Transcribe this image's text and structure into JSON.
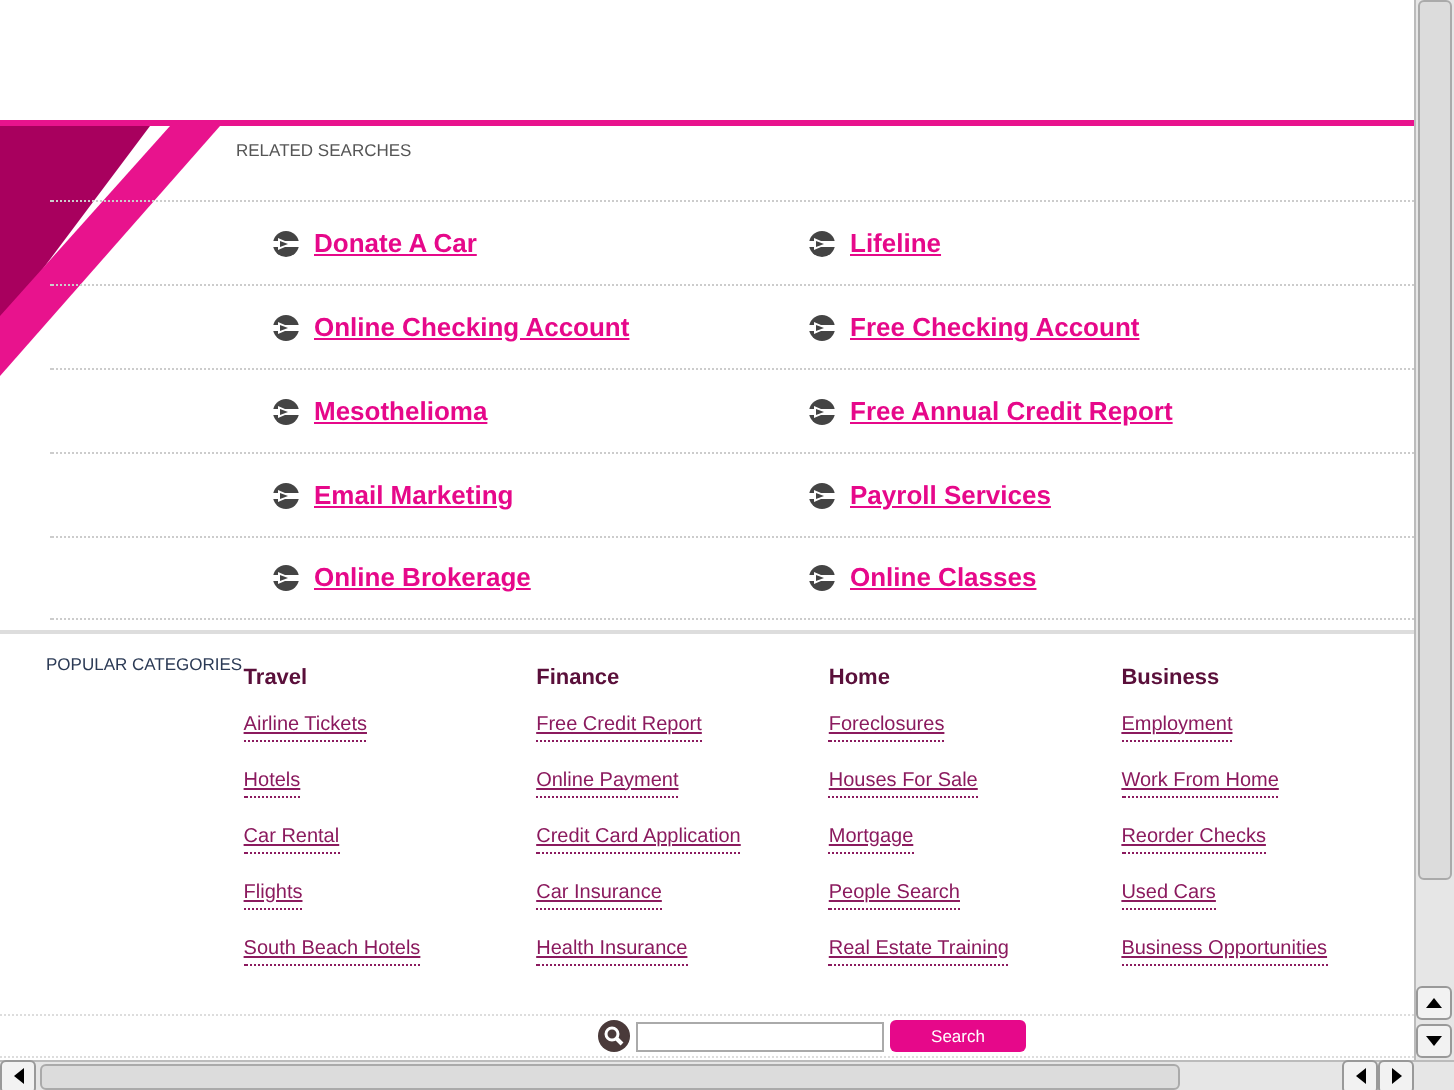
{
  "related_searches": {
    "label": "RELATED SEARCHES",
    "links": [
      "Donate A Car",
      "Lifeline",
      "Online Checking Account",
      "Free Checking Account",
      "Mesothelioma",
      "Free Annual Credit Report",
      "Email Marketing",
      "Payroll Services",
      "Online Brokerage",
      "Online Classes"
    ]
  },
  "popular_categories": {
    "label": "POPULAR CATEGORIES",
    "columns": [
      {
        "title": "Travel",
        "items": [
          "Airline Tickets",
          "Hotels",
          "Car Rental",
          "Flights",
          "South Beach Hotels"
        ]
      },
      {
        "title": "Finance",
        "items": [
          "Free Credit Report",
          "Online Payment",
          "Credit Card Application",
          "Car Insurance",
          "Health Insurance"
        ]
      },
      {
        "title": "Home",
        "items": [
          "Foreclosures",
          "Houses For Sale",
          "Mortgage",
          "People Search",
          "Real Estate Training"
        ]
      },
      {
        "title": "Business",
        "items": [
          "Employment",
          "Work From Home",
          "Reorder Checks",
          "Used Cars",
          "Business Opportunities"
        ]
      }
    ]
  },
  "search": {
    "button": "Search"
  }
}
